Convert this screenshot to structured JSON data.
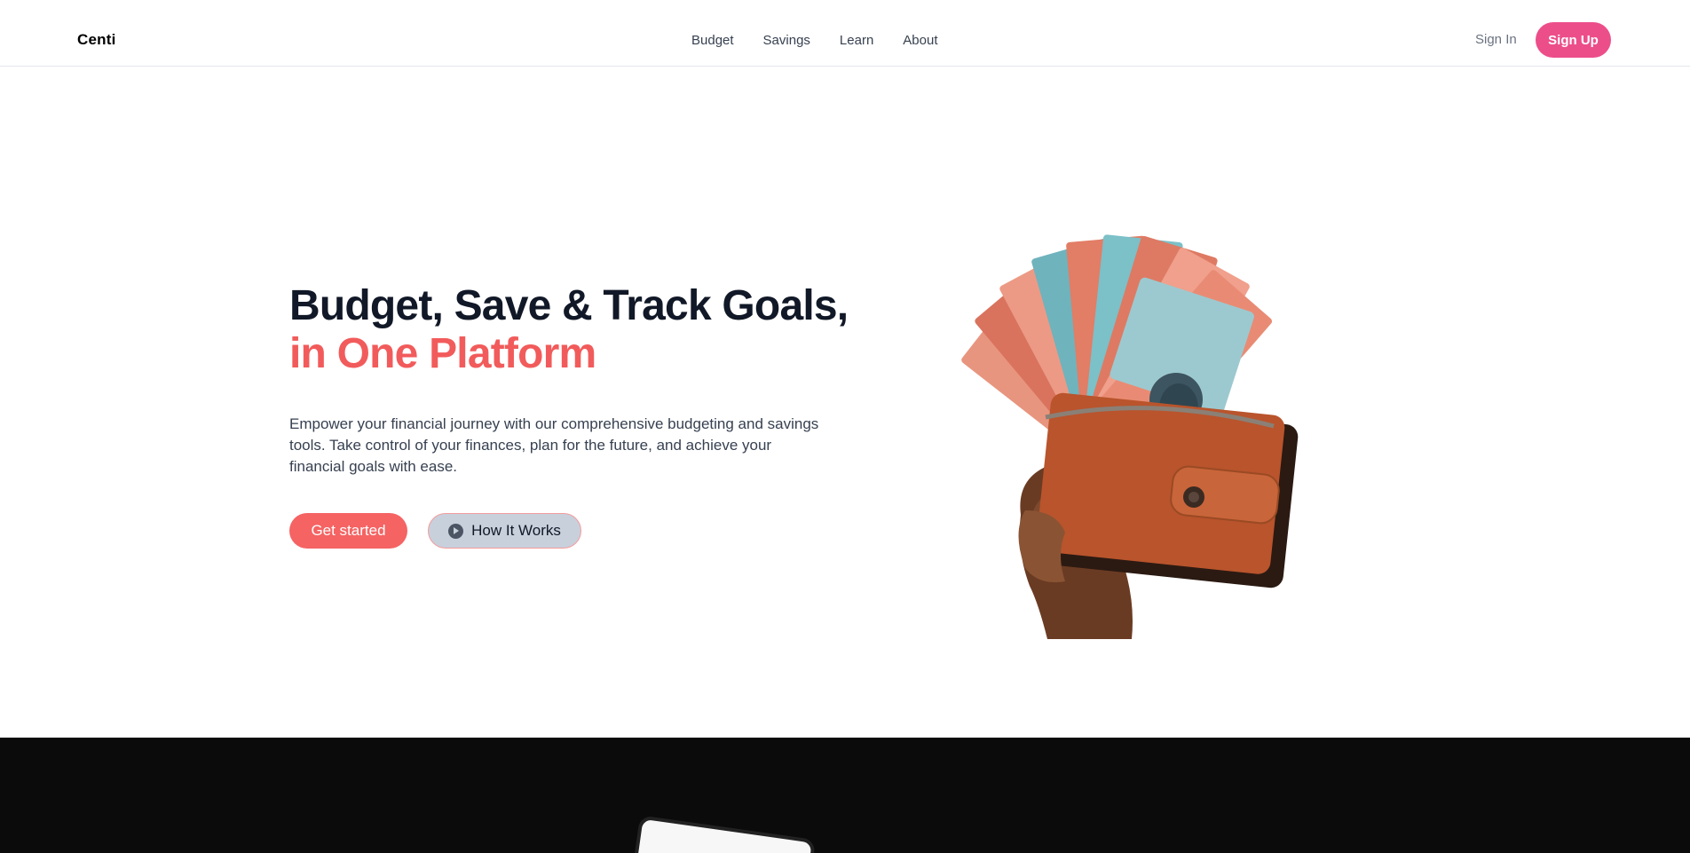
{
  "header": {
    "brand": "Centi",
    "nav": [
      {
        "label": "Budget"
      },
      {
        "label": "Savings"
      },
      {
        "label": "Learn"
      },
      {
        "label": "About"
      }
    ],
    "sign_in": "Sign In",
    "sign_up": "Sign Up"
  },
  "hero": {
    "title_line1": "Budget, Save & Track Goals,",
    "title_line2": "in One Platform",
    "description": "Empower your financial journey with our comprehensive budgeting and savings tools. Take control of your finances, plan for the future, and achieve your financial goals with ease.",
    "primary_cta": "Get started",
    "secondary_cta": "How It Works",
    "secondary_icon": "play-circle-icon"
  },
  "colors": {
    "accent": "#f25b5b",
    "sign_up": "#ec4e8a",
    "secondary_button": "#c8d0dc",
    "dark_section": "#0b0b0b"
  }
}
